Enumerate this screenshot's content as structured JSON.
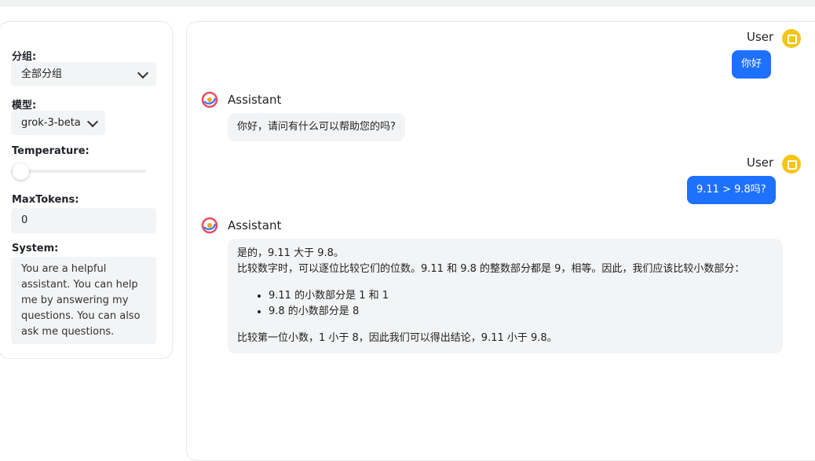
{
  "sidebar": {
    "group_label": "分组:",
    "group_value": "全部分组",
    "model_label": "模型:",
    "model_value": "grok-3-beta",
    "temperature_label": "Temperature:",
    "temperature_value": 0,
    "maxtokens_label": "MaxTokens:",
    "maxtokens_value": "0",
    "system_label": "System:",
    "system_value": "You are a helpful assistant. You can help me by answering my questions. You can also ask me questions."
  },
  "chat": {
    "messages": [
      {
        "role": "User",
        "text": "你好"
      },
      {
        "role": "Assistant",
        "text": "你好，请问有什么可以帮助您的吗?"
      },
      {
        "role": "User",
        "text": "9.11 > 9.8吗?"
      },
      {
        "role": "Assistant",
        "line1": "是的，9.11 大于 9.8。",
        "line2": "比较数字时，可以逐位比较它们的位数。9.11 和 9.8 的整数部分都是 9，相等。因此，我们应该比较小数部分：",
        "bullets": [
          "9.11 的小数部分是 1 和 1",
          "9.8 的小数部分是 8"
        ],
        "line3": "比较第一位小数，1 小于 8，因此我们可以得出结论，9.11 小于 9.8。"
      }
    ]
  },
  "colors": {
    "user_bubble": "#1e70ff",
    "user_avatar": "#f5c518",
    "bot_bubble": "#f3f4f5"
  },
  "icons": {
    "user_avatar": "user-avatar-icon",
    "assistant_avatar": "assistant-avatar-icon",
    "dropdown": "chevron-down-icon"
  }
}
